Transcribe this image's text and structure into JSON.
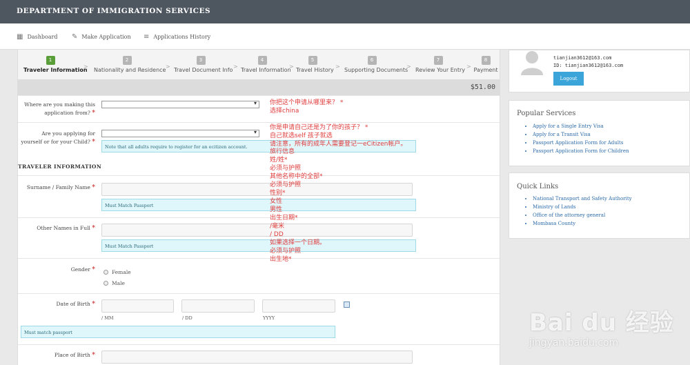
{
  "header": {
    "brand": "DEPARTMENT OF IMMIGRATION SERVICES"
  },
  "nav": [
    {
      "label": "Dashboard",
      "icon": "dashboard-icon"
    },
    {
      "label": "Make Application",
      "icon": "pencil-icon"
    },
    {
      "label": "Applications History",
      "icon": "list-icon"
    }
  ],
  "wizard": {
    "steps": [
      {
        "num": "1",
        "label": "Traveler Information"
      },
      {
        "num": "2",
        "label": "Nationality and Residence"
      },
      {
        "num": "3",
        "label": "Travel Document Info"
      },
      {
        "num": "4",
        "label": "Travel Information"
      },
      {
        "num": "5",
        "label": "Travel History"
      },
      {
        "num": "6",
        "label": "Supporting Documents"
      },
      {
        "num": "7",
        "label": "Review Your Entry"
      },
      {
        "num": "8",
        "label": "Payment"
      }
    ],
    "separator": ">",
    "active_step": 1
  },
  "price": "$51.00",
  "form": {
    "q_from": "Where are you making this application from?",
    "q_for": "Are you applying for yourself or for your Child?",
    "note_adults": "Note that all adults require to register for an ecitizen account.",
    "section_title": "TRAVELER INFORMATION",
    "surname_label": "Surname / Family Name",
    "surname_note": "Must Match Passport",
    "other_label": "Other Names in Full",
    "other_note": "Must Match Passport",
    "gender_label": "Gender",
    "gender_female": "Female",
    "gender_male": "Male",
    "dob_label": "Date of Birth",
    "dob_mm": "/ MM",
    "dob_dd": "/ DD",
    "dob_yyyy": "YYYY",
    "dob_note": "Must match passport",
    "pob_label": "Place of Birth",
    "required_mark": "*"
  },
  "annotations": [
    "你把这个申请从哪里来？ *",
    "选择china",
    "你是申请自己还是为了你的孩子？ *",
    "自己就选self 孩子就选",
    "请注意，所有的成年人需要登记一eCitizen帐户。",
    "旅行信息",
    "姓/姓*",
    "必须与护照",
    "其他名称中的全部*",
    "必须与护照",
    "性别*",
    "女性",
    "男性",
    "出生日期*",
    "/毫米",
    "/ DD",
    "如果选择一个日期。",
    "必须与护照",
    "出生地*"
  ],
  "user": {
    "email": "tianjian3612@163.com",
    "id_label": "ID: tianjian3612@163.com",
    "logout": "Logout"
  },
  "popular": {
    "title": "Popular Services",
    "items": [
      "Apply for a Single Entry Visa",
      "Apply for a Transit Visa",
      "Passport Application Form for Adults",
      "Passport Application Form for Children"
    ]
  },
  "quick": {
    "title": "Quick Links",
    "items": [
      "National Transport and Safety Authority",
      "Ministry of Lands",
      "Office of the attorney general",
      "Mombasa County"
    ]
  },
  "watermark": {
    "logo": "Bai du 经验",
    "url": "jingyan.baidu.com"
  },
  "colors": {
    "header": "#4e5660",
    "active_step": "#5a9e3a",
    "required": "#d23b3b",
    "annotation": "#e03b3b",
    "logout": "#3ba4d9",
    "link": "#2b6aa8"
  }
}
